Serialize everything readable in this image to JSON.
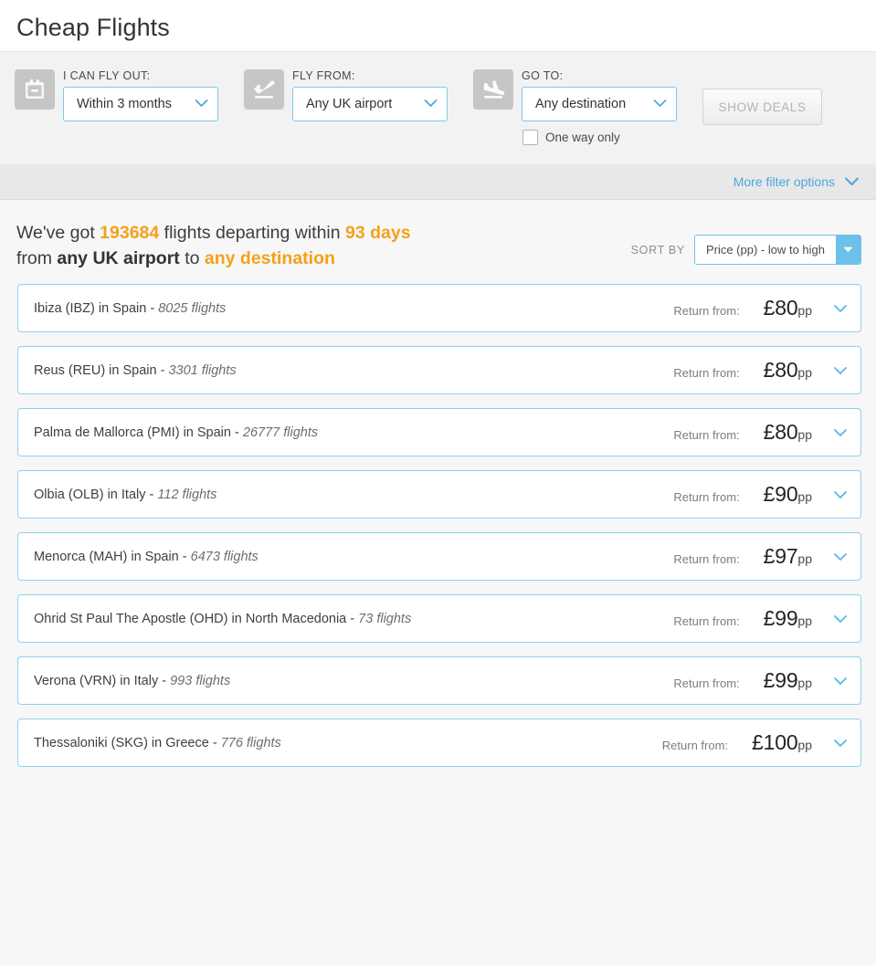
{
  "page": {
    "title": "Cheap Flights"
  },
  "colors": {
    "accent_blue": "#4aa8dd",
    "border_blue": "#8dd0ef",
    "highlight_orange": "#f6a01a",
    "filter_bg": "#f2f2f2",
    "strip_bg": "#e8e8e8",
    "results_bg": "#f7f7f7",
    "icon_tile": "#c6c6c6"
  },
  "filters": {
    "date": {
      "icon": "calendar-icon",
      "label": "I CAN FLY OUT:",
      "value": "Within 3 months",
      "chevron": "chevron-down-icon"
    },
    "origin": {
      "icon": "plane-departure-icon",
      "label": "FLY FROM:",
      "value": "Any UK airport",
      "chevron": "chevron-down-icon"
    },
    "destination": {
      "icon": "plane-arrival-icon",
      "label": "GO TO:",
      "value": "Any destination",
      "chevron": "chevron-down-icon"
    },
    "submit_label": "SHOW DEALS",
    "one_way": {
      "label": "One way only",
      "checked": false
    },
    "more_options": {
      "label": "More filter options",
      "chevron": "chevron-down-icon"
    }
  },
  "results": {
    "summary": {
      "prefix": "We've got ",
      "flight_count": "193684",
      "mid1": " flights departing within ",
      "days": "93 days",
      "line2_prefix": "from ",
      "origin": "any UK airport",
      "mid2": " to ",
      "destination": "any destination"
    },
    "sort": {
      "label": "SORT BY",
      "value": "Price (pp) - low to high",
      "arrow": "caret-down-icon"
    },
    "return_from_label": "Return from:",
    "row_chevron": "chevron-down-icon",
    "rows": [
      {
        "destination": "Ibiza (IBZ) in Spain",
        "separator": " - ",
        "flights": "8025 flights",
        "currency": "£",
        "price": "80",
        "unit": "pp"
      },
      {
        "destination": "Reus (REU) in Spain",
        "separator": " - ",
        "flights": "3301 flights",
        "currency": "£",
        "price": "80",
        "unit": "pp"
      },
      {
        "destination": "Palma de Mallorca (PMI) in Spain",
        "separator": " - ",
        "flights": "26777 flights",
        "currency": "£",
        "price": "80",
        "unit": "pp"
      },
      {
        "destination": "Olbia (OLB) in Italy",
        "separator": " - ",
        "flights": "112 flights",
        "currency": "£",
        "price": "90",
        "unit": "pp"
      },
      {
        "destination": "Menorca (MAH) in Spain",
        "separator": " - ",
        "flights": "6473 flights",
        "currency": "£",
        "price": "97",
        "unit": "pp"
      },
      {
        "destination": "Ohrid St Paul The Apostle (OHD) in North Macedonia",
        "separator": " - ",
        "flights": "73 flights",
        "currency": "£",
        "price": "99",
        "unit": "pp"
      },
      {
        "destination": "Verona (VRN) in Italy",
        "separator": " - ",
        "flights": "993 flights",
        "currency": "£",
        "price": "99",
        "unit": "pp"
      },
      {
        "destination": "Thessaloniki (SKG) in Greece",
        "separator": " - ",
        "flights": "776 flights",
        "currency": "£",
        "price": "100",
        "unit": "pp"
      }
    ]
  }
}
